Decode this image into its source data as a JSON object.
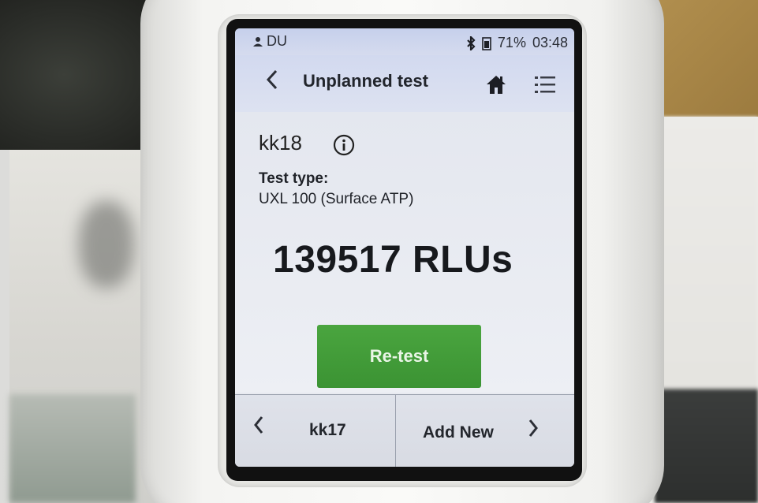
{
  "status_bar": {
    "user_icon": "user-icon",
    "user": "DU",
    "bluetooth_icon": "bluetooth-icon",
    "battery_icon": "battery-icon",
    "battery": "71%",
    "time": "03:48"
  },
  "header": {
    "back_icon": "chevron-left-icon",
    "title": "Unplanned test",
    "home_icon": "home-icon",
    "menu_icon": "list-menu-icon"
  },
  "content": {
    "test_id": "kk18",
    "info_icon": "info-icon",
    "test_type_label": "Test type:",
    "test_type_value": "UXL 100 (Surface ATP)",
    "result": "139517 RLUs",
    "retest_label": "Re-test",
    "colors": {
      "retest_bg": "#3f9a36",
      "status_bar_bg": "#c9d2ec"
    }
  },
  "bottom_nav": {
    "prev_label": "kk17",
    "next_label": "Add New"
  }
}
